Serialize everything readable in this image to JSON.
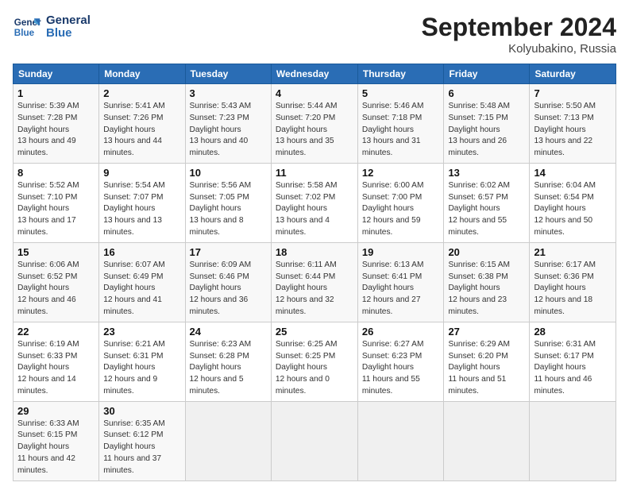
{
  "header": {
    "logo_line1": "General",
    "logo_line2": "Blue",
    "month": "September 2024",
    "location": "Kolyubakino, Russia"
  },
  "weekdays": [
    "Sunday",
    "Monday",
    "Tuesday",
    "Wednesday",
    "Thursday",
    "Friday",
    "Saturday"
  ],
  "weeks": [
    [
      {
        "day": "1",
        "sunrise": "5:39 AM",
        "sunset": "7:28 PM",
        "daylight": "13 hours and 49 minutes."
      },
      {
        "day": "2",
        "sunrise": "5:41 AM",
        "sunset": "7:26 PM",
        "daylight": "13 hours and 44 minutes."
      },
      {
        "day": "3",
        "sunrise": "5:43 AM",
        "sunset": "7:23 PM",
        "daylight": "13 hours and 40 minutes."
      },
      {
        "day": "4",
        "sunrise": "5:44 AM",
        "sunset": "7:20 PM",
        "daylight": "13 hours and 35 minutes."
      },
      {
        "day": "5",
        "sunrise": "5:46 AM",
        "sunset": "7:18 PM",
        "daylight": "13 hours and 31 minutes."
      },
      {
        "day": "6",
        "sunrise": "5:48 AM",
        "sunset": "7:15 PM",
        "daylight": "13 hours and 26 minutes."
      },
      {
        "day": "7",
        "sunrise": "5:50 AM",
        "sunset": "7:13 PM",
        "daylight": "13 hours and 22 minutes."
      }
    ],
    [
      {
        "day": "8",
        "sunrise": "5:52 AM",
        "sunset": "7:10 PM",
        "daylight": "13 hours and 17 minutes."
      },
      {
        "day": "9",
        "sunrise": "5:54 AM",
        "sunset": "7:07 PM",
        "daylight": "13 hours and 13 minutes."
      },
      {
        "day": "10",
        "sunrise": "5:56 AM",
        "sunset": "7:05 PM",
        "daylight": "13 hours and 8 minutes."
      },
      {
        "day": "11",
        "sunrise": "5:58 AM",
        "sunset": "7:02 PM",
        "daylight": "13 hours and 4 minutes."
      },
      {
        "day": "12",
        "sunrise": "6:00 AM",
        "sunset": "7:00 PM",
        "daylight": "12 hours and 59 minutes."
      },
      {
        "day": "13",
        "sunrise": "6:02 AM",
        "sunset": "6:57 PM",
        "daylight": "12 hours and 55 minutes."
      },
      {
        "day": "14",
        "sunrise": "6:04 AM",
        "sunset": "6:54 PM",
        "daylight": "12 hours and 50 minutes."
      }
    ],
    [
      {
        "day": "15",
        "sunrise": "6:06 AM",
        "sunset": "6:52 PM",
        "daylight": "12 hours and 46 minutes."
      },
      {
        "day": "16",
        "sunrise": "6:07 AM",
        "sunset": "6:49 PM",
        "daylight": "12 hours and 41 minutes."
      },
      {
        "day": "17",
        "sunrise": "6:09 AM",
        "sunset": "6:46 PM",
        "daylight": "12 hours and 36 minutes."
      },
      {
        "day": "18",
        "sunrise": "6:11 AM",
        "sunset": "6:44 PM",
        "daylight": "12 hours and 32 minutes."
      },
      {
        "day": "19",
        "sunrise": "6:13 AM",
        "sunset": "6:41 PM",
        "daylight": "12 hours and 27 minutes."
      },
      {
        "day": "20",
        "sunrise": "6:15 AM",
        "sunset": "6:38 PM",
        "daylight": "12 hours and 23 minutes."
      },
      {
        "day": "21",
        "sunrise": "6:17 AM",
        "sunset": "6:36 PM",
        "daylight": "12 hours and 18 minutes."
      }
    ],
    [
      {
        "day": "22",
        "sunrise": "6:19 AM",
        "sunset": "6:33 PM",
        "daylight": "12 hours and 14 minutes."
      },
      {
        "day": "23",
        "sunrise": "6:21 AM",
        "sunset": "6:31 PM",
        "daylight": "12 hours and 9 minutes."
      },
      {
        "day": "24",
        "sunrise": "6:23 AM",
        "sunset": "6:28 PM",
        "daylight": "12 hours and 5 minutes."
      },
      {
        "day": "25",
        "sunrise": "6:25 AM",
        "sunset": "6:25 PM",
        "daylight": "12 hours and 0 minutes."
      },
      {
        "day": "26",
        "sunrise": "6:27 AM",
        "sunset": "6:23 PM",
        "daylight": "11 hours and 55 minutes."
      },
      {
        "day": "27",
        "sunrise": "6:29 AM",
        "sunset": "6:20 PM",
        "daylight": "11 hours and 51 minutes."
      },
      {
        "day": "28",
        "sunrise": "6:31 AM",
        "sunset": "6:17 PM",
        "daylight": "11 hours and 46 minutes."
      }
    ],
    [
      {
        "day": "29",
        "sunrise": "6:33 AM",
        "sunset": "6:15 PM",
        "daylight": "11 hours and 42 minutes."
      },
      {
        "day": "30",
        "sunrise": "6:35 AM",
        "sunset": "6:12 PM",
        "daylight": "11 hours and 37 minutes."
      },
      null,
      null,
      null,
      null,
      null
    ]
  ],
  "labels": {
    "sunrise": "Sunrise:",
    "sunset": "Sunset:",
    "daylight": "Daylight hours"
  }
}
